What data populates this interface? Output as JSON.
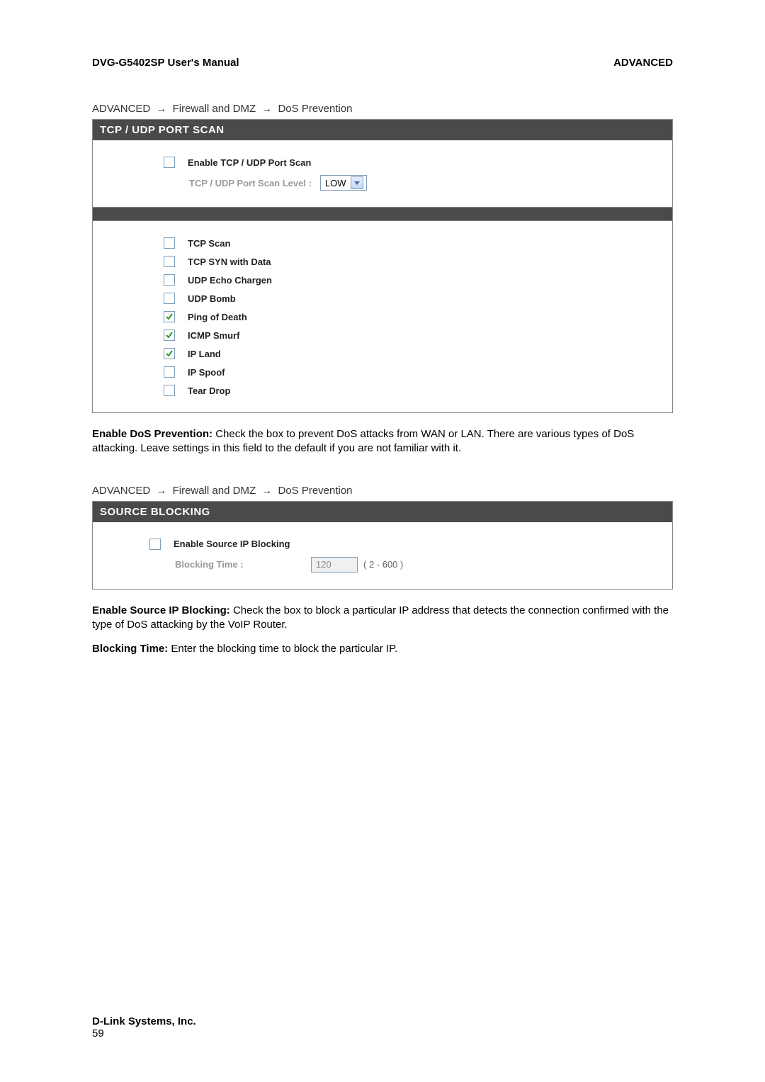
{
  "header": {
    "left": "DVG-G5402SP User's Manual",
    "right": "ADVANCED"
  },
  "breadcrumb1": {
    "a": "ADVANCED",
    "b": "Firewall and DMZ",
    "c": "DoS Prevention"
  },
  "panelPortScan": {
    "title": "TCP / UDP PORT SCAN",
    "enableLabel": "Enable TCP / UDP Port Scan",
    "levelLabel": "TCP / UDP Port Scan Level :",
    "levelValue": "LOW"
  },
  "checks": {
    "tcpScan": {
      "label": "TCP Scan",
      "checked": false
    },
    "tcpSyn": {
      "label": "TCP SYN with Data",
      "checked": false
    },
    "udpEcho": {
      "label": "UDP Echo Chargen",
      "checked": false
    },
    "udpBomb": {
      "label": "UDP Bomb",
      "checked": false
    },
    "pingDeath": {
      "label": "Ping of Death",
      "checked": true
    },
    "icmpSmurf": {
      "label": "ICMP Smurf",
      "checked": true
    },
    "ipLand": {
      "label": "IP Land",
      "checked": true
    },
    "ipSpoof": {
      "label": "IP Spoof",
      "checked": false
    },
    "tearDrop": {
      "label": "Tear Drop",
      "checked": false
    }
  },
  "para1": {
    "bold": "Enable DoS Prevention:",
    "text": " Check the box to prevent DoS attacks from WAN or LAN. There are various types of DoS attacking. Leave settings in this field to the default if you are not familiar with it."
  },
  "breadcrumb2": {
    "a": "ADVANCED",
    "b": "Firewall and DMZ",
    "c": "DoS Prevention"
  },
  "panelSource": {
    "title": "SOURCE BLOCKING",
    "enableLabel": "Enable Source IP Blocking",
    "timeLabel": "Blocking Time :",
    "timeValue": "120",
    "timeHint": "( 2 - 600 )"
  },
  "para2": {
    "bold": "Enable Source IP Blocking:",
    "text": " Check the box to block a particular IP address that detects the connection confirmed with the type of DoS attacking by the VoIP Router."
  },
  "para3": {
    "bold": "Blocking Time:",
    "text": " Enter the blocking time to block the particular IP."
  },
  "footer": {
    "company": "D-Link Systems, Inc.",
    "page": "59"
  },
  "arrow": "→"
}
